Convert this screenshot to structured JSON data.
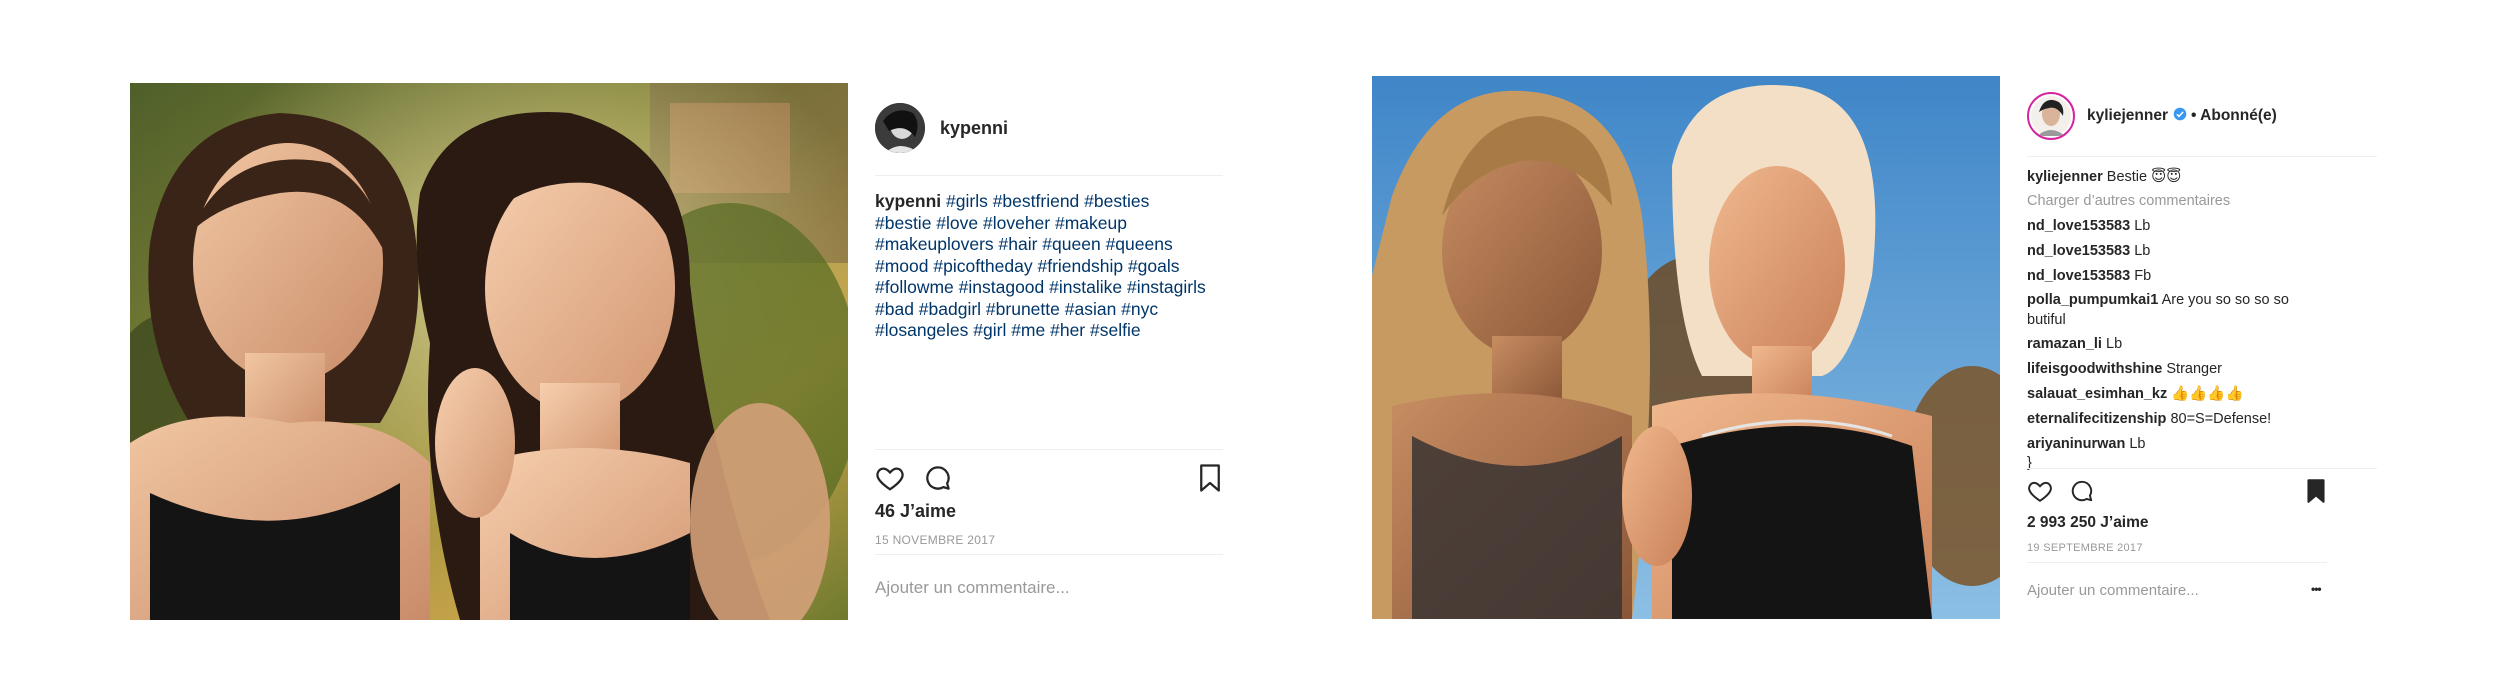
{
  "post1": {
    "username": "kypenni",
    "caption_user": "kypenni",
    "hashtags_lines": [
      "#girls #bestfriend #besties",
      "#bestie #love #loveher #makeup",
      "#makeuplovers #hair #queen #queens",
      "#mood #picoftheday #friendship #goals",
      "#followme #instagood #instalike #instagirls",
      "#bad #badgirl #brunette #asian #nyc",
      "#losangeles #girl #me #her #selfie"
    ],
    "likes": "46 J’aime",
    "date": "15 NOVEMBRE 2017",
    "add_comment_placeholder": "Ajouter un commentaire...",
    "icons": [
      "heart-icon",
      "comment-icon",
      "bookmark-icon"
    ]
  },
  "post2": {
    "username": "kyliejenner",
    "follow_status": "• Abonné(e)",
    "caption_user": "kyliejenner",
    "caption_text": "Bestie 😇😇",
    "load_more": "Charger d’autres commentaires",
    "comments": [
      {
        "user": "nd_love153583",
        "text": "Lb"
      },
      {
        "user": "nd_love153583",
        "text": "Lb"
      },
      {
        "user": "nd_love153583",
        "text": "Fb"
      },
      {
        "user": "polla_pumpumkai1",
        "text": "Are you so so so so butiful"
      },
      {
        "user": "ramazan_li",
        "text": "Lb"
      },
      {
        "user": "lifeisgoodwithshine",
        "text": "Stranger"
      },
      {
        "user": "salauat_esimhan_kz",
        "text": "👍👍👍👍"
      },
      {
        "user": "eternalifecitizenship",
        "text": "80=S=Defense!"
      },
      {
        "user": "ariyaninurwan",
        "text": "Lb"
      }
    ],
    "likes": "2 993 250 J’aime",
    "date": "19 SEPTEMBRE 2017",
    "add_comment_placeholder": "Ajouter un commentaire...",
    "more_options": "•••",
    "icons": [
      "heart-icon",
      "comment-icon",
      "bookmark-filled-icon",
      "verified-badge-icon"
    ]
  }
}
